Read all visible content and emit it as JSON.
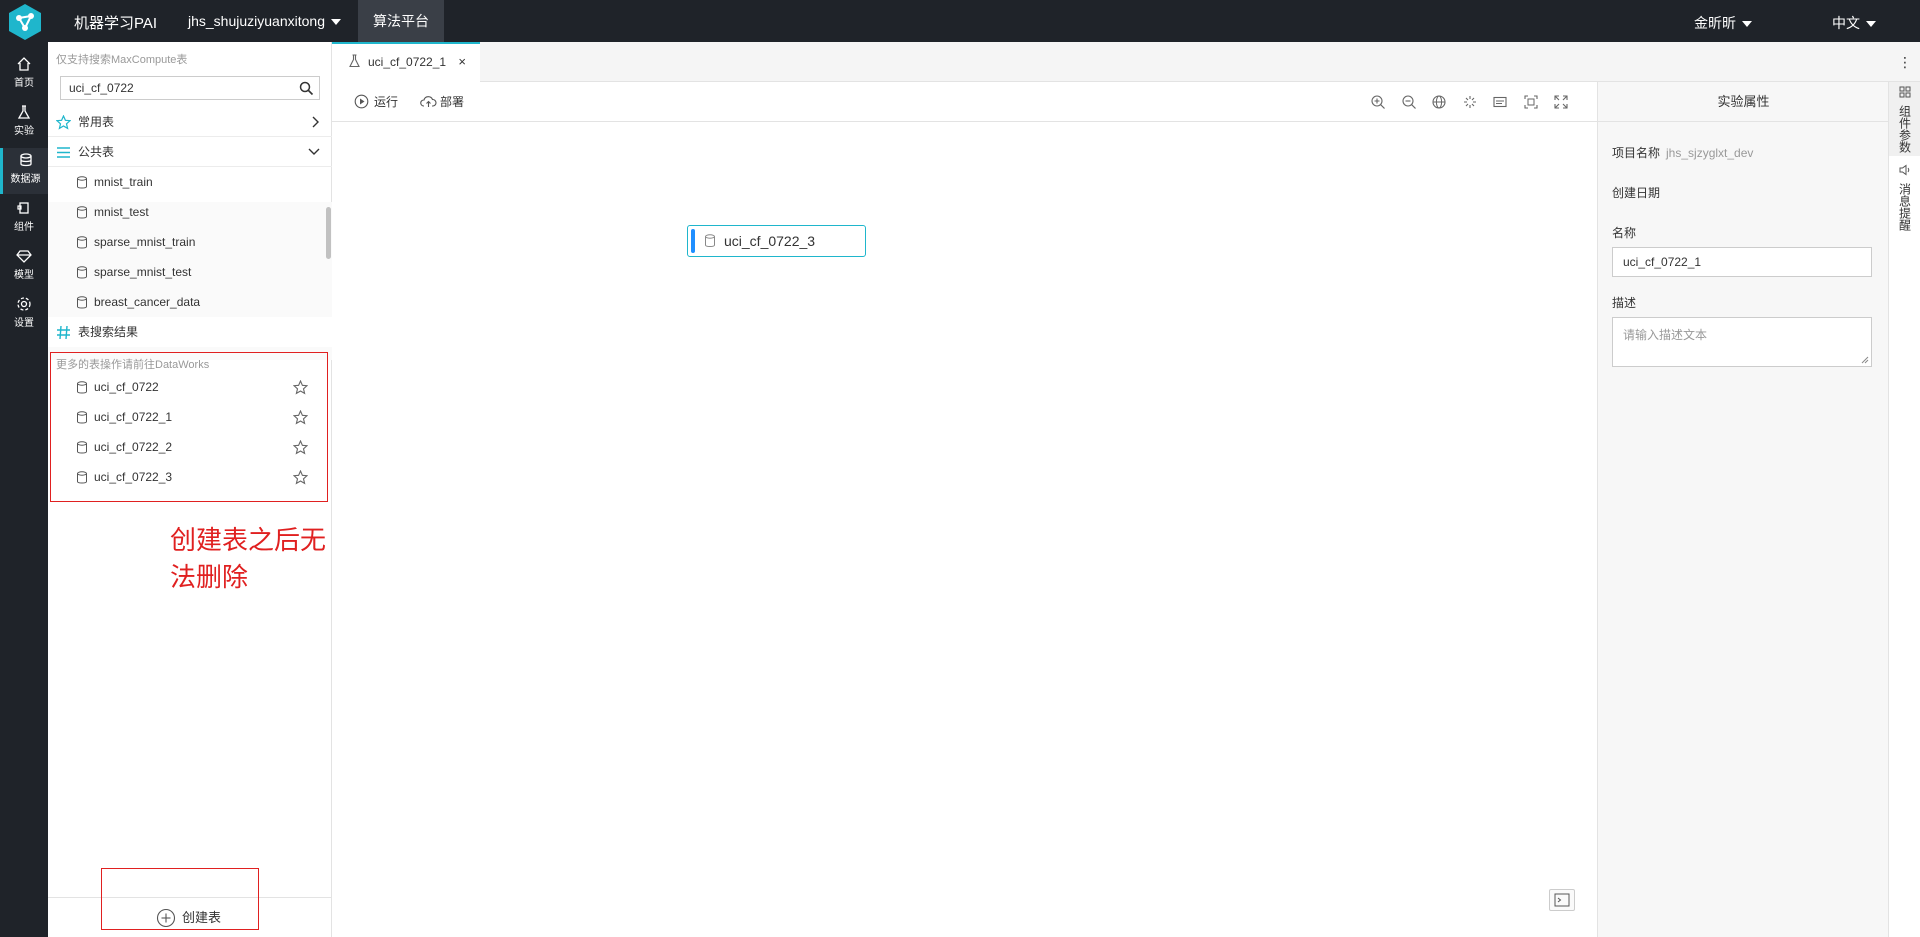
{
  "topbar": {
    "app_title": "机器学习PAI",
    "project": "jhs_shujuziyuanxitong",
    "algo_tab": "算法平台",
    "user": "金昕昕",
    "language": "中文"
  },
  "leftnav": {
    "items": [
      {
        "label": "首页",
        "icon": "home-icon"
      },
      {
        "label": "实验",
        "icon": "flask-icon"
      },
      {
        "label": "数据源",
        "icon": "database-icon"
      },
      {
        "label": "组件",
        "icon": "component-icon"
      },
      {
        "label": "模型",
        "icon": "diamond-icon"
      },
      {
        "label": "设置",
        "icon": "gear-icon"
      }
    ],
    "active_index": 2
  },
  "datasource": {
    "search_hint": "仅支持搜索MaxCompute表",
    "search_value": "uci_cf_0722",
    "favorites_label": "常用表",
    "public_label": "公共表",
    "public_tables": [
      "mnist_train",
      "mnist_test",
      "sparse_mnist_train",
      "sparse_mnist_test",
      "breast_cancer_data"
    ],
    "search_results_label": "表搜索结果",
    "more_hint": "更多的表操作请前往DataWorks",
    "result_tables": [
      "uci_cf_0722",
      "uci_cf_0722_1",
      "uci_cf_0722_2",
      "uci_cf_0722_3"
    ],
    "annotation": "创建表之后无法删除",
    "create_label": "创建表"
  },
  "editor": {
    "tab_label": "uci_cf_0722_1",
    "close": "×",
    "run_label": "运行",
    "deploy_label": "部署",
    "node_label": "uci_cf_0722_3"
  },
  "properties": {
    "title": "实验属性",
    "project_name_label": "项目名称",
    "project_name_value": "jhs_sjzyglxt_dev",
    "created_label": "创建日期",
    "name_label": "名称",
    "name_value": "uci_cf_0722_1",
    "desc_label": "描述",
    "desc_placeholder": "请输入描述文本"
  },
  "right_strip": {
    "component_params": "组件参数",
    "message_reminder": "消息提醒"
  },
  "colors": {
    "topbar": "#1f2329",
    "accent": "#1fb6cc",
    "annotation_red": "#e02020"
  }
}
